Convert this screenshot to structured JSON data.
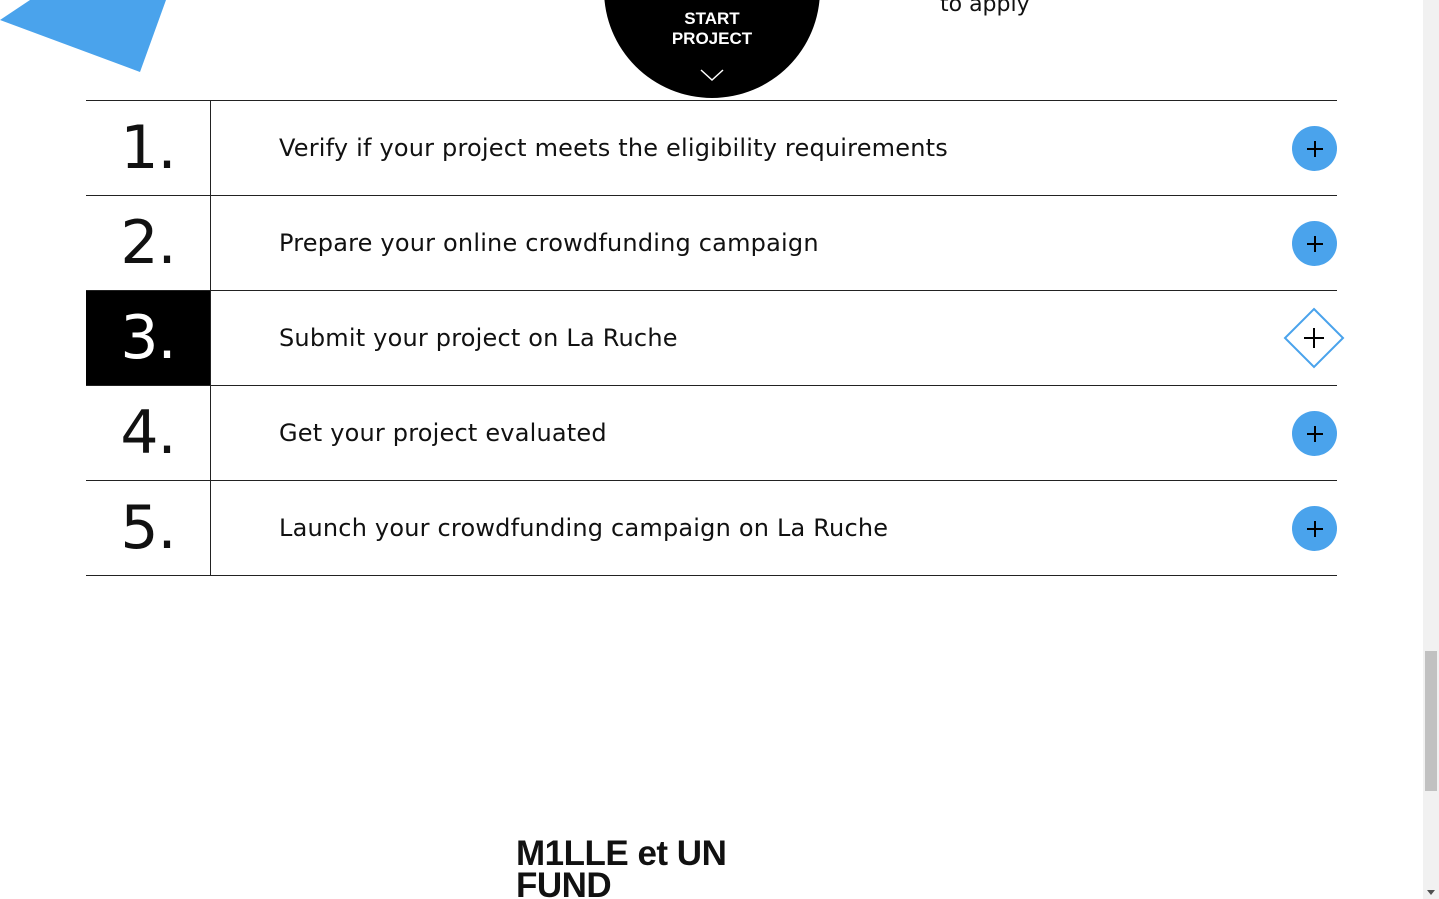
{
  "header": {
    "cut_text": "to apply",
    "start_button": {
      "line1": "START",
      "line2": "PROJECT",
      "chevron_icon": "chevron-down-icon"
    }
  },
  "steps": [
    {
      "number": "1.",
      "title": "Verify if your project meets the eligibility requirements",
      "icon": "plus-icon",
      "active": false
    },
    {
      "number": "2.",
      "title": "Prepare your online crowdfunding campaign",
      "icon": "plus-icon",
      "active": false
    },
    {
      "number": "3.",
      "title": "Submit your project on La Ruche",
      "icon": "plus-icon",
      "active": true
    },
    {
      "number": "4.",
      "title": "Get your project evaluated",
      "icon": "plus-icon",
      "active": false
    },
    {
      "number": "5.",
      "title": "Launch your crowdfunding campaign on La Ruche",
      "icon": "plus-icon",
      "active": false
    }
  ],
  "footer": {
    "logo_line1": "M1LLE et UN",
    "logo_line2": "FUND"
  },
  "colors": {
    "accent_blue": "#4aa3ec",
    "deco_blue": "#4aa3ec",
    "text": "#111111",
    "active_bg": "#000000"
  }
}
